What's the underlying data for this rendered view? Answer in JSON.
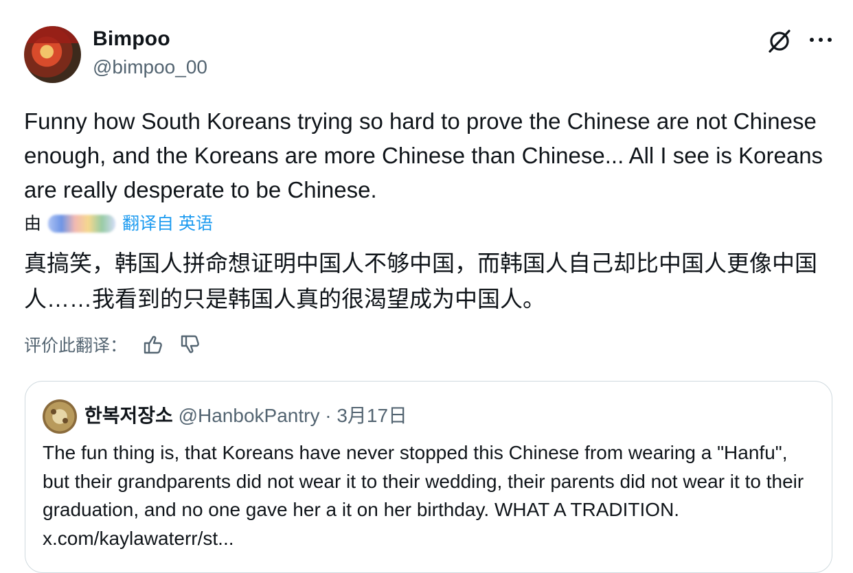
{
  "author": {
    "display_name": "Bimpoo",
    "handle": "@bimpoo_00"
  },
  "icons": {
    "grok": "grok-icon",
    "more": "more-icon",
    "thumbs_up": "thumbs-up-icon",
    "thumbs_down": "thumbs-down-icon"
  },
  "tweet": {
    "text": "Funny how South Koreans trying so hard to prove the Chinese are not Chinese enough, and the Koreans are more Chinese than Chinese... All I see is Koreans are really desperate to be Chinese."
  },
  "translation": {
    "by_label": "由",
    "link_text": "翻译自 英语",
    "text": "真搞笑，韩国人拼命想证明中国人不够中国，而韩国人自己却比中国人更像中国人……我看到的只是韩国人真的很渴望成为中国人。",
    "rate_label": "评价此翻译："
  },
  "quote": {
    "name": "한복저장소",
    "handle": "@HanbokPantry",
    "separator": "·",
    "date": "3月17日",
    "text": "The fun thing is, that Koreans have never stopped this Chinese from wearing a \"Hanfu\", but their grandparents did not wear it to their wedding, their parents did not wear it to their graduation, and no one gave her a it on her birthday. WHAT A TRADITION. x.com/kaylawaterr/st..."
  },
  "colors": {
    "text": "#0f1419",
    "secondary": "#536471",
    "link": "#1d9bf0",
    "border": "#cfd9de"
  }
}
